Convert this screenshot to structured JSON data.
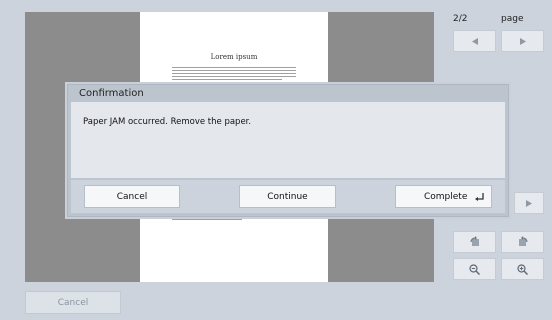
{
  "preview": {
    "page_title": "Lorem ipsum"
  },
  "pager": {
    "current": "2/2",
    "unit_label": "page",
    "prev_icon": "triangle-left-icon",
    "next_icon": "triangle-right-icon"
  },
  "side_tools": {
    "rotate_left_icon": "rotate-left-icon",
    "rotate_right_icon": "rotate-right-icon",
    "zoom_out_icon": "zoom-out-icon",
    "zoom_in_icon": "zoom-in-icon"
  },
  "bottom_bar": {
    "cancel_label": "Cancel"
  },
  "dialog": {
    "title": "Confirmation",
    "message": "Paper JAM occurred. Remove the paper.",
    "buttons": {
      "cancel": "Cancel",
      "continue": "Continue",
      "complete": "Complete"
    },
    "complete_icon": "enter-icon"
  },
  "colors": {
    "background": "#ccd3dc",
    "preview_gray": "#8c8c8c",
    "dialog_frame": "#bcc4ce",
    "dialog_body": "#e4e8ed"
  }
}
